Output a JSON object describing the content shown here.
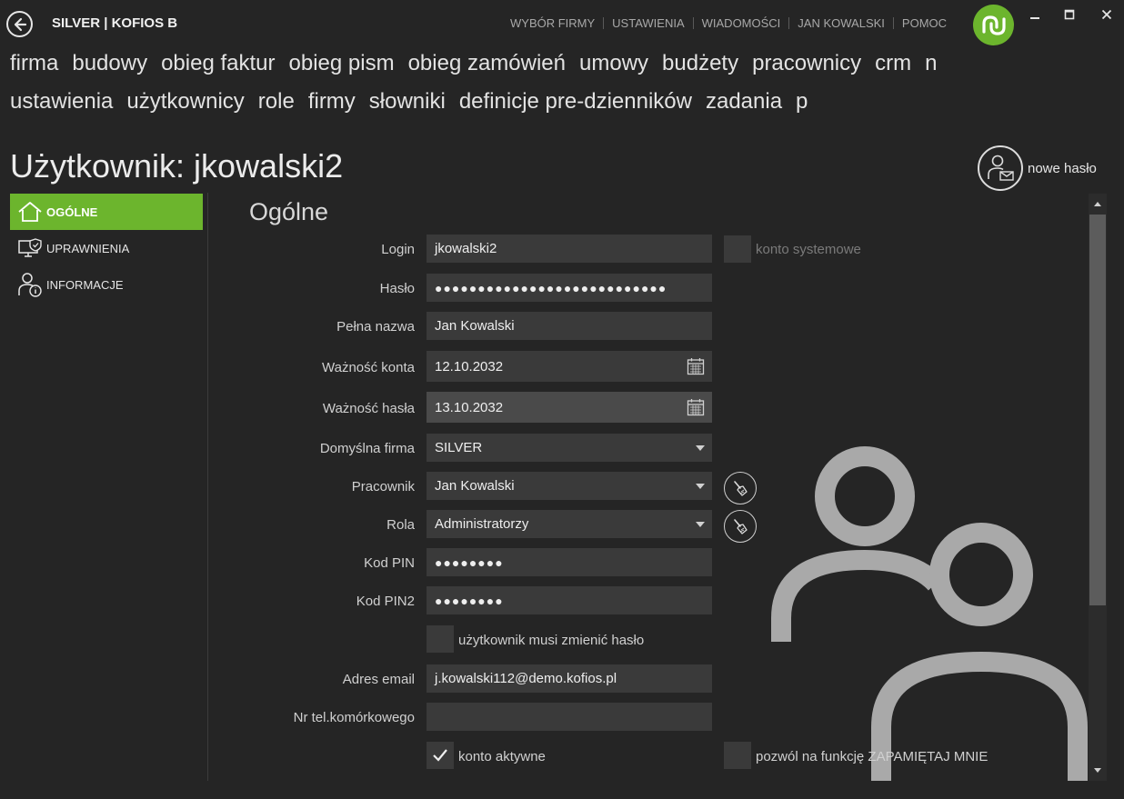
{
  "app": {
    "title": "SILVER | KOFIOS B"
  },
  "topnav": {
    "items": [
      {
        "label": "WYBÓR FIRMY"
      },
      {
        "label": "USTAWIENIA"
      },
      {
        "label": "WIADOMOŚCI"
      },
      {
        "label": "JAN KOWALSKI"
      },
      {
        "label": "POMOC"
      }
    ]
  },
  "menu1": [
    "firma",
    "budowy",
    "obieg faktur",
    "obieg pism",
    "obieg zamówień",
    "umowy",
    "budżety",
    "pracownicy",
    "crm",
    "n"
  ],
  "menu2": [
    "ustawienia",
    "użytkownicy",
    "role",
    "firmy",
    "słowniki",
    "definicje pre-dzienników",
    "zadania",
    "p"
  ],
  "page": {
    "title": "Użytkownik: jkowalski2",
    "new_password_label": "nowe hasło"
  },
  "sidebar": {
    "items": [
      {
        "label": "OGÓLNE",
        "icon": "home-icon",
        "active": true
      },
      {
        "label": "UPRAWNIENIA",
        "icon": "monitor-shield-icon",
        "active": false
      },
      {
        "label": "INFORMACJE",
        "icon": "user-info-icon",
        "active": false
      }
    ]
  },
  "section": {
    "title": "Ogólne"
  },
  "form": {
    "login": {
      "label": "Login",
      "value": "jkowalski2"
    },
    "system_account": {
      "label": "konto systemowe",
      "checked": false
    },
    "password": {
      "label": "Hasło",
      "value": "●●●●●●●●●●●●●●●●●●●●●●●●●●●"
    },
    "full_name": {
      "label": "Pełna nazwa",
      "value": "Jan Kowalski"
    },
    "account_valid": {
      "label": "Ważność konta",
      "value": "12.10.2032"
    },
    "password_valid": {
      "label": "Ważność hasła",
      "value": "13.10.2032"
    },
    "default_company": {
      "label": "Domyślna firma",
      "value": "SILVER"
    },
    "employee": {
      "label": "Pracownik",
      "value": "Jan Kowalski"
    },
    "role": {
      "label": "Rola",
      "value": "Administratorzy"
    },
    "pin": {
      "label": "Kod PIN",
      "value": "●●●●●●●●"
    },
    "pin2": {
      "label": "Kod PIN2",
      "value": "●●●●●●●●"
    },
    "must_change_password": {
      "label": "użytkownik musi zmienić hasło",
      "checked": false
    },
    "email": {
      "label": "Adres email",
      "value": "j.kowalski112@demo.kofios.pl"
    },
    "mobile": {
      "label": "Nr tel.komórkowego",
      "value": ""
    },
    "account_active": {
      "label": "konto aktywne",
      "checked": true
    },
    "remember_me": {
      "label": "pozwól na funkcję ZAPAMIĘTAJ MNIE",
      "checked": false
    }
  },
  "colors": {
    "accent": "#6cb52d",
    "background": "#252525",
    "field": "#3a3a3a"
  }
}
